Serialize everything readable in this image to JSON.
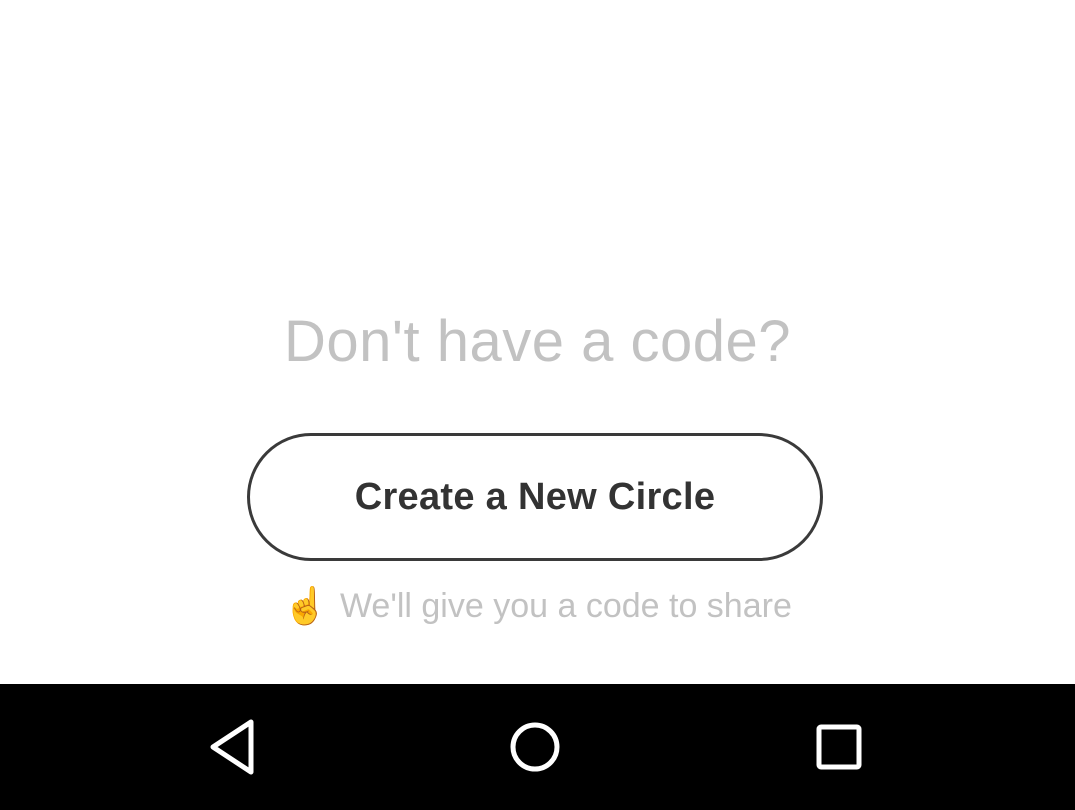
{
  "main": {
    "question": "Don't have a code?",
    "create_button_label": "Create a New Circle",
    "hint": {
      "icon": "pointing-up-hand-emoji",
      "icon_glyph": "☝",
      "text": "We'll give you a code to share"
    }
  },
  "nav_bar": {
    "back_icon": "back-triangle-icon",
    "home_icon": "home-circle-icon",
    "recents_icon": "recents-square-icon"
  },
  "colors": {
    "background": "#ffffff",
    "muted_text": "#c2c2c2",
    "button_border": "#3a3a3a",
    "button_text": "#333333",
    "hint_icon": "#f1b51c",
    "nav_bar": "#000000",
    "nav_icon": "#ffffff"
  }
}
